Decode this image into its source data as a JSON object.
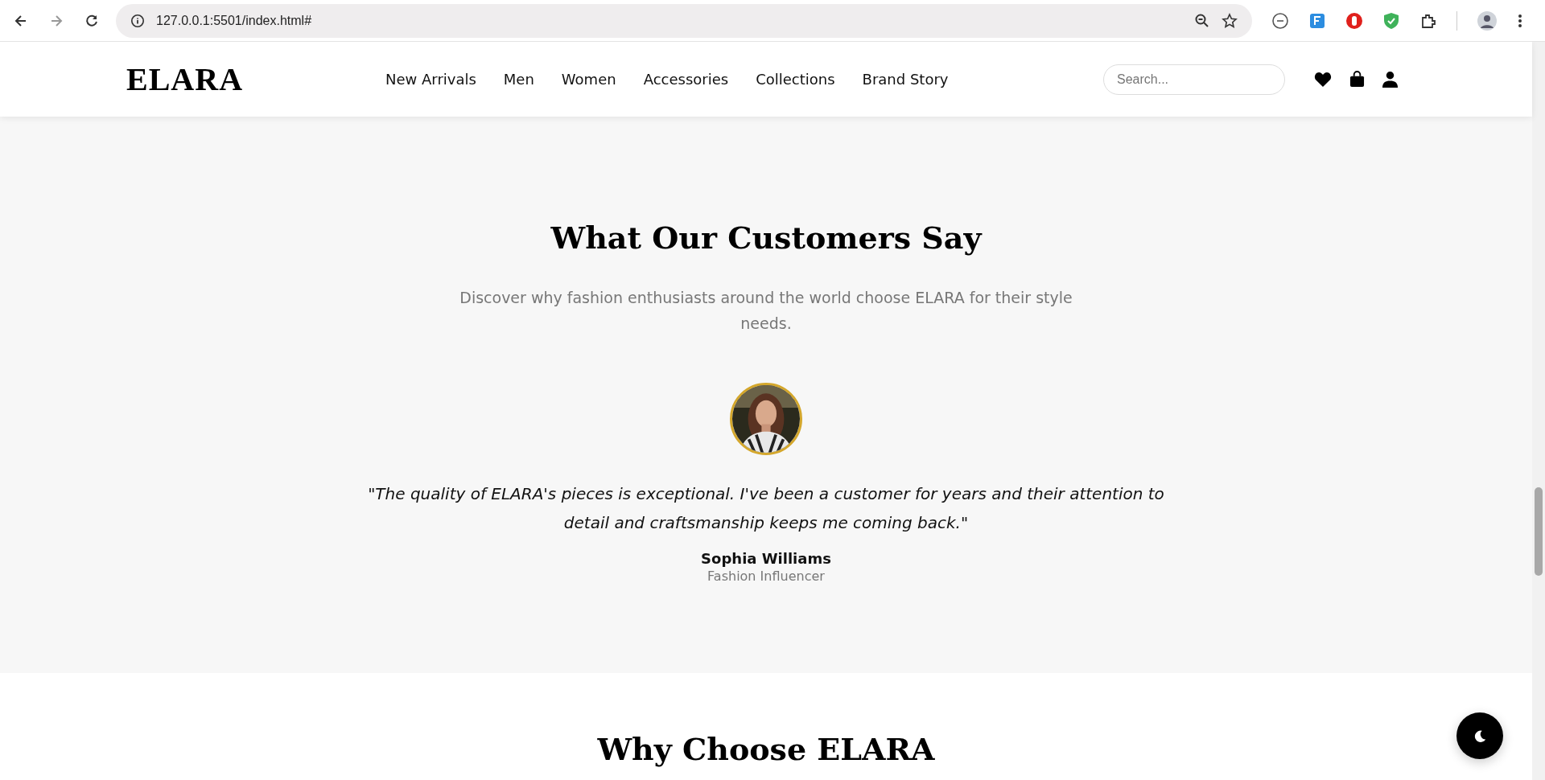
{
  "browser": {
    "url": "127.0.0.1:5501/index.html#"
  },
  "header": {
    "logo": "ELARA",
    "nav": [
      {
        "label": "New Arrivals"
      },
      {
        "label": "Men"
      },
      {
        "label": "Women"
      },
      {
        "label": "Accessories"
      },
      {
        "label": "Collections"
      },
      {
        "label": "Brand Story"
      }
    ],
    "search": {
      "placeholder": "Search..."
    }
  },
  "testimonials": {
    "title": "What Our Customers Say",
    "subtitle": "Discover why fashion enthusiasts around the world choose ELARA for their style needs.",
    "quote": "\"The quality of ELARA's pieces is exceptional. I've been a customer for years and their attention to detail and craftsmanship keeps me coming back.\"",
    "name": "Sophia Williams",
    "role": "Fashion Influencer"
  },
  "why": {
    "title": "Why Choose ELARA"
  }
}
